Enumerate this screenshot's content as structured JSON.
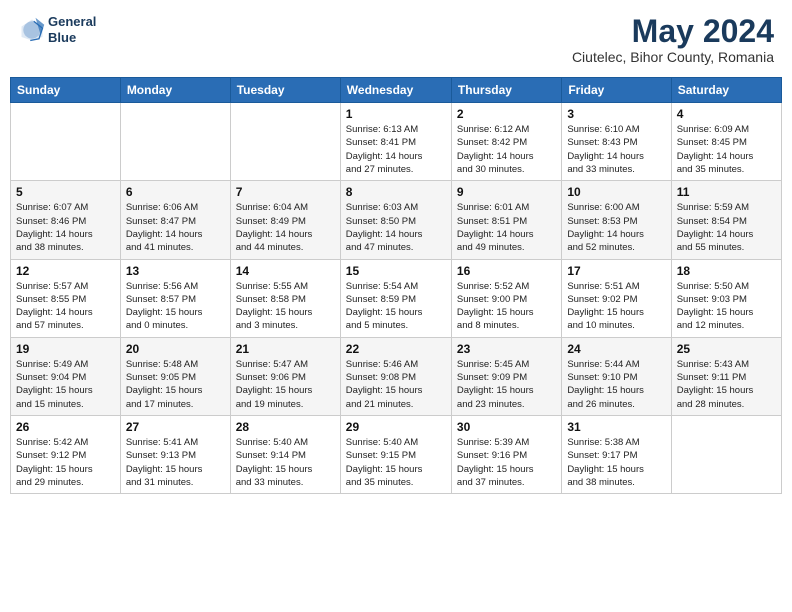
{
  "logo": {
    "line1": "General",
    "line2": "Blue"
  },
  "title": "May 2024",
  "subtitle": "Ciutelec, Bihor County, Romania",
  "weekdays": [
    "Sunday",
    "Monday",
    "Tuesday",
    "Wednesday",
    "Thursday",
    "Friday",
    "Saturday"
  ],
  "weeks": [
    [
      {
        "day": "",
        "info": ""
      },
      {
        "day": "",
        "info": ""
      },
      {
        "day": "",
        "info": ""
      },
      {
        "day": "1",
        "info": "Sunrise: 6:13 AM\nSunset: 8:41 PM\nDaylight: 14 hours\nand 27 minutes."
      },
      {
        "day": "2",
        "info": "Sunrise: 6:12 AM\nSunset: 8:42 PM\nDaylight: 14 hours\nand 30 minutes."
      },
      {
        "day": "3",
        "info": "Sunrise: 6:10 AM\nSunset: 8:43 PM\nDaylight: 14 hours\nand 33 minutes."
      },
      {
        "day": "4",
        "info": "Sunrise: 6:09 AM\nSunset: 8:45 PM\nDaylight: 14 hours\nand 35 minutes."
      }
    ],
    [
      {
        "day": "5",
        "info": "Sunrise: 6:07 AM\nSunset: 8:46 PM\nDaylight: 14 hours\nand 38 minutes."
      },
      {
        "day": "6",
        "info": "Sunrise: 6:06 AM\nSunset: 8:47 PM\nDaylight: 14 hours\nand 41 minutes."
      },
      {
        "day": "7",
        "info": "Sunrise: 6:04 AM\nSunset: 8:49 PM\nDaylight: 14 hours\nand 44 minutes."
      },
      {
        "day": "8",
        "info": "Sunrise: 6:03 AM\nSunset: 8:50 PM\nDaylight: 14 hours\nand 47 minutes."
      },
      {
        "day": "9",
        "info": "Sunrise: 6:01 AM\nSunset: 8:51 PM\nDaylight: 14 hours\nand 49 minutes."
      },
      {
        "day": "10",
        "info": "Sunrise: 6:00 AM\nSunset: 8:53 PM\nDaylight: 14 hours\nand 52 minutes."
      },
      {
        "day": "11",
        "info": "Sunrise: 5:59 AM\nSunset: 8:54 PM\nDaylight: 14 hours\nand 55 minutes."
      }
    ],
    [
      {
        "day": "12",
        "info": "Sunrise: 5:57 AM\nSunset: 8:55 PM\nDaylight: 14 hours\nand 57 minutes."
      },
      {
        "day": "13",
        "info": "Sunrise: 5:56 AM\nSunset: 8:57 PM\nDaylight: 15 hours\nand 0 minutes."
      },
      {
        "day": "14",
        "info": "Sunrise: 5:55 AM\nSunset: 8:58 PM\nDaylight: 15 hours\nand 3 minutes."
      },
      {
        "day": "15",
        "info": "Sunrise: 5:54 AM\nSunset: 8:59 PM\nDaylight: 15 hours\nand 5 minutes."
      },
      {
        "day": "16",
        "info": "Sunrise: 5:52 AM\nSunset: 9:00 PM\nDaylight: 15 hours\nand 8 minutes."
      },
      {
        "day": "17",
        "info": "Sunrise: 5:51 AM\nSunset: 9:02 PM\nDaylight: 15 hours\nand 10 minutes."
      },
      {
        "day": "18",
        "info": "Sunrise: 5:50 AM\nSunset: 9:03 PM\nDaylight: 15 hours\nand 12 minutes."
      }
    ],
    [
      {
        "day": "19",
        "info": "Sunrise: 5:49 AM\nSunset: 9:04 PM\nDaylight: 15 hours\nand 15 minutes."
      },
      {
        "day": "20",
        "info": "Sunrise: 5:48 AM\nSunset: 9:05 PM\nDaylight: 15 hours\nand 17 minutes."
      },
      {
        "day": "21",
        "info": "Sunrise: 5:47 AM\nSunset: 9:06 PM\nDaylight: 15 hours\nand 19 minutes."
      },
      {
        "day": "22",
        "info": "Sunrise: 5:46 AM\nSunset: 9:08 PM\nDaylight: 15 hours\nand 21 minutes."
      },
      {
        "day": "23",
        "info": "Sunrise: 5:45 AM\nSunset: 9:09 PM\nDaylight: 15 hours\nand 23 minutes."
      },
      {
        "day": "24",
        "info": "Sunrise: 5:44 AM\nSunset: 9:10 PM\nDaylight: 15 hours\nand 26 minutes."
      },
      {
        "day": "25",
        "info": "Sunrise: 5:43 AM\nSunset: 9:11 PM\nDaylight: 15 hours\nand 28 minutes."
      }
    ],
    [
      {
        "day": "26",
        "info": "Sunrise: 5:42 AM\nSunset: 9:12 PM\nDaylight: 15 hours\nand 29 minutes."
      },
      {
        "day": "27",
        "info": "Sunrise: 5:41 AM\nSunset: 9:13 PM\nDaylight: 15 hours\nand 31 minutes."
      },
      {
        "day": "28",
        "info": "Sunrise: 5:40 AM\nSunset: 9:14 PM\nDaylight: 15 hours\nand 33 minutes."
      },
      {
        "day": "29",
        "info": "Sunrise: 5:40 AM\nSunset: 9:15 PM\nDaylight: 15 hours\nand 35 minutes."
      },
      {
        "day": "30",
        "info": "Sunrise: 5:39 AM\nSunset: 9:16 PM\nDaylight: 15 hours\nand 37 minutes."
      },
      {
        "day": "31",
        "info": "Sunrise: 5:38 AM\nSunset: 9:17 PM\nDaylight: 15 hours\nand 38 minutes."
      },
      {
        "day": "",
        "info": ""
      }
    ]
  ]
}
